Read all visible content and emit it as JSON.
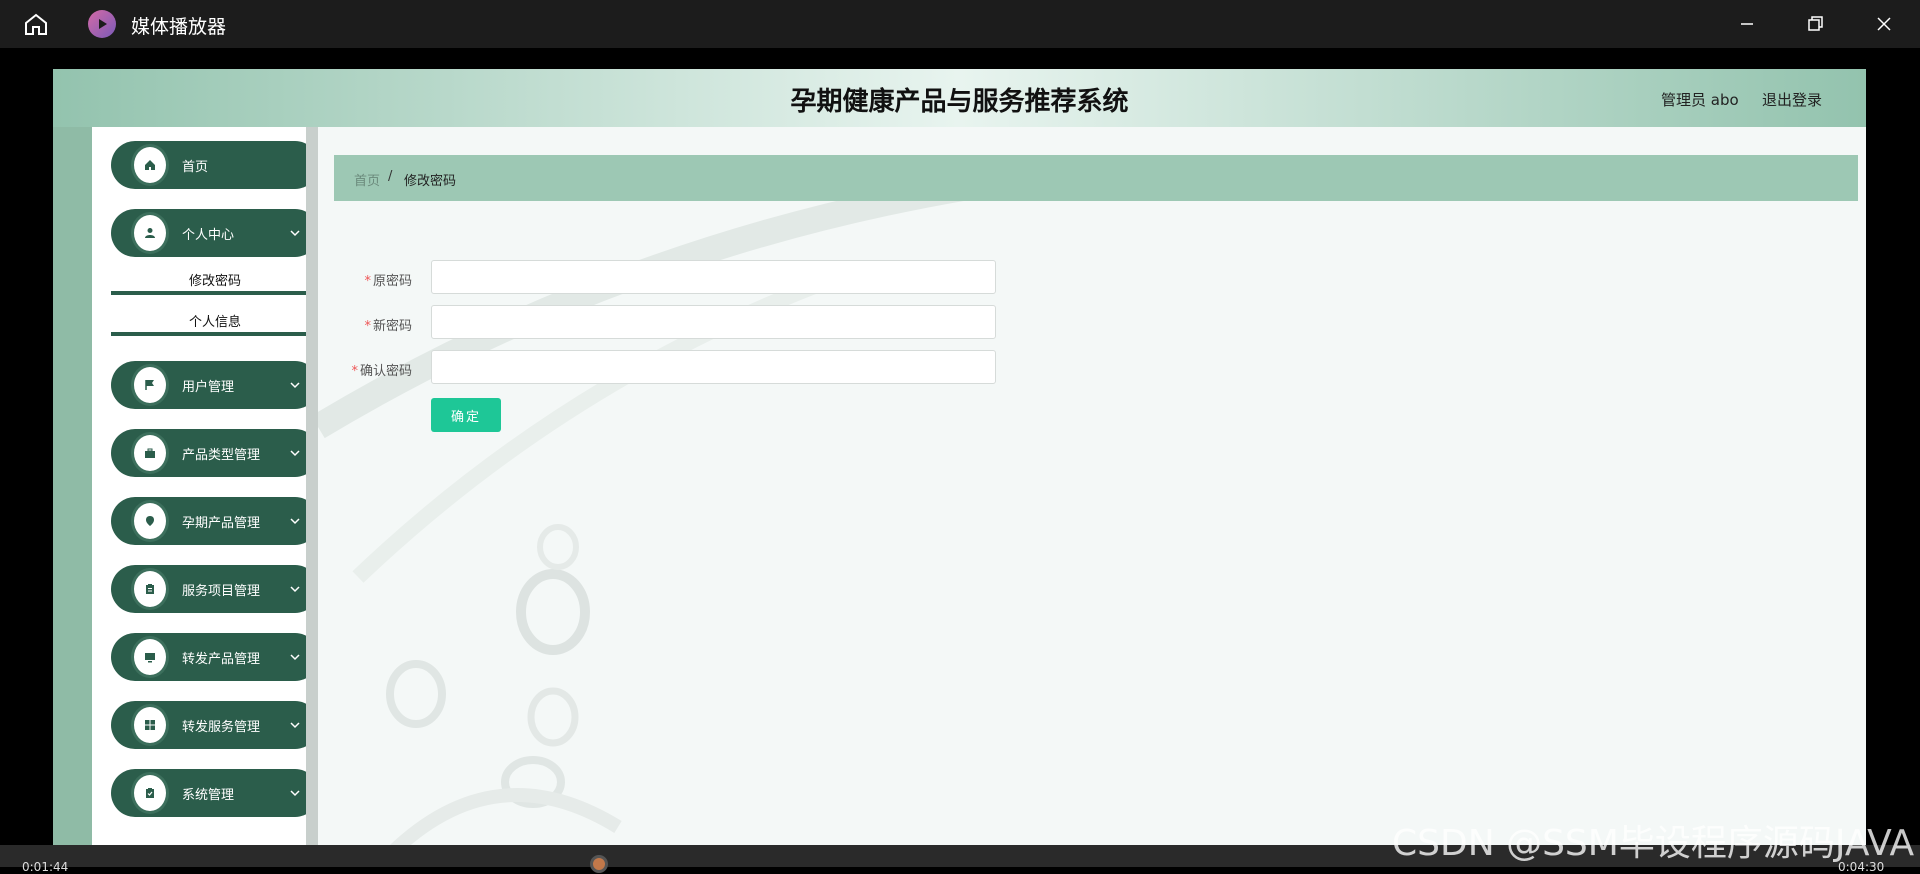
{
  "window": {
    "title": "媒体播放器"
  },
  "header": {
    "site_title": "孕期健康产品与服务推荐系统",
    "user_text": "管理员 abo",
    "logout_label": "退出登录"
  },
  "sidebar": {
    "items": [
      {
        "label": "首页",
        "icon": "home-icon"
      },
      {
        "label": "个人中心",
        "icon": "user-icon",
        "expanded": true
      },
      {
        "label": "用户管理",
        "icon": "flag-icon"
      },
      {
        "label": "产品类型管理",
        "icon": "briefcase-icon"
      },
      {
        "label": "孕期产品管理",
        "icon": "location-pin-icon"
      },
      {
        "label": "服务项目管理",
        "icon": "clipboard-icon"
      },
      {
        "label": "转发产品管理",
        "icon": "monitor-icon"
      },
      {
        "label": "转发服务管理",
        "icon": "grid-icon"
      },
      {
        "label": "系统管理",
        "icon": "clipboard-check-icon"
      }
    ],
    "submenu": [
      {
        "label": "修改密码"
      },
      {
        "label": "个人信息"
      }
    ]
  },
  "breadcrumb": {
    "home": "首页",
    "separator": "/",
    "current": "修改密码"
  },
  "form": {
    "required_mark": "*",
    "fields": [
      {
        "label": "原密码",
        "value": ""
      },
      {
        "label": "新密码",
        "value": ""
      },
      {
        "label": "确认密码",
        "value": ""
      }
    ],
    "submit_label": "确定"
  },
  "watermark": "CSDN @SSM毕设程序源码JAVA",
  "player": {
    "elapsed": "0:01:44",
    "duration": "0:04:30"
  },
  "colors": {
    "sidebar_item": "#2b5d4b",
    "header_accent": "#93c3ae",
    "breadcrumb_bg": "#9dc8b4",
    "submit_button": "#1ec797",
    "required_star": "#ee5555"
  }
}
